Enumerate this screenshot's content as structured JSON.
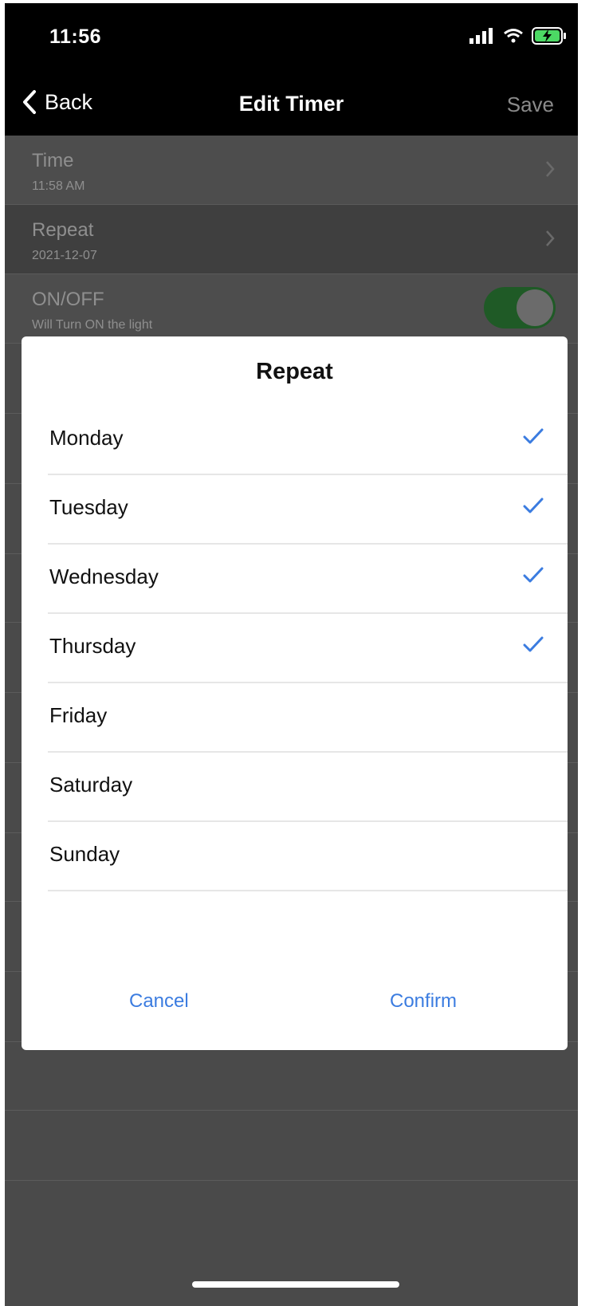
{
  "status_bar": {
    "time": "11:56"
  },
  "nav": {
    "back_label": "Back",
    "title": "Edit Timer",
    "save_label": "Save"
  },
  "settings": {
    "time": {
      "title": "Time",
      "value": "11:58 AM"
    },
    "repeat": {
      "title": "Repeat",
      "value": "2021-12-07"
    },
    "onoff": {
      "title": "ON/OFF",
      "subtitle": "Will Turn ON the light",
      "enabled": true
    }
  },
  "modal": {
    "title": "Repeat",
    "days": [
      {
        "label": "Monday",
        "checked": true
      },
      {
        "label": "Tuesday",
        "checked": true
      },
      {
        "label": "Wednesday",
        "checked": true
      },
      {
        "label": "Thursday",
        "checked": true
      },
      {
        "label": "Friday",
        "checked": false
      },
      {
        "label": "Saturday",
        "checked": false
      },
      {
        "label": "Sunday",
        "checked": false
      }
    ],
    "cancel_label": "Cancel",
    "confirm_label": "Confirm"
  },
  "colors": {
    "accent": "#3b7ce0",
    "toggle_on": "#1f5a26",
    "overlay_bg": "#4a4a4a"
  }
}
